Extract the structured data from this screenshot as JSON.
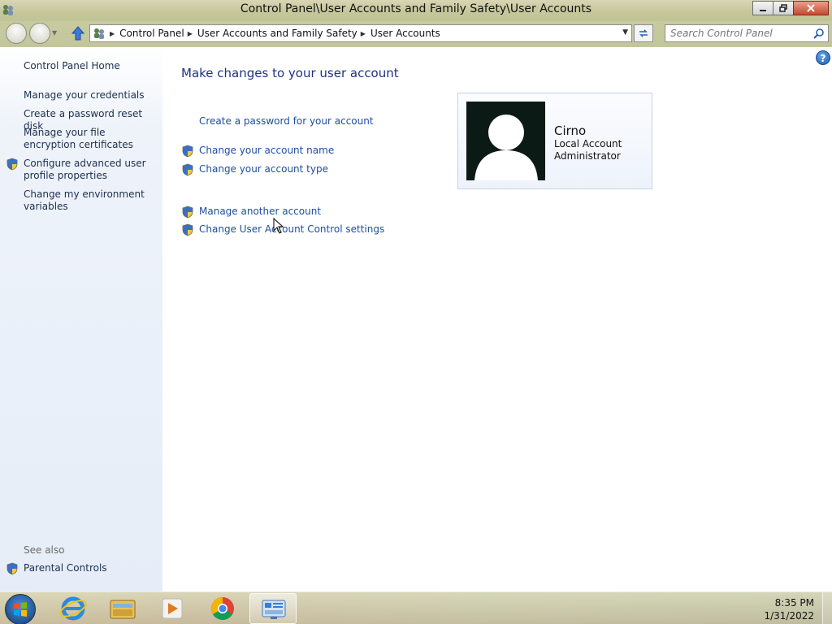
{
  "window": {
    "title": "Control Panel\\User Accounts and Family Safety\\User Accounts"
  },
  "addressbar": {
    "crumbs": [
      "Control Panel",
      "User Accounts and Family Safety",
      "User Accounts"
    ],
    "search_placeholder": "Search Control Panel"
  },
  "sidebar": {
    "home": "Control Panel Home",
    "links": [
      "Manage your credentials",
      "Create a password reset disk",
      "Manage your file encryption certificates",
      "Configure advanced user profile properties",
      "Change my environment variables"
    ],
    "see_also_label": "See also",
    "see_also_links": [
      "Parental Controls"
    ]
  },
  "main": {
    "title": "Make changes to your user account",
    "tasks": [
      "Create a password for your account",
      "Change your account name",
      "Change your account type",
      "Manage another account",
      "Change User Account Control settings"
    ]
  },
  "user": {
    "name": "Cirno",
    "account_kind": "Local Account",
    "role": "Administrator"
  },
  "taskbar": {
    "apps": [
      "internet-explorer-icon",
      "file-explorer-icon",
      "media-player-icon",
      "chrome-icon",
      "control-panel-icon"
    ],
    "time": "8:35 PM",
    "date": "1/31/2022"
  },
  "colors": {
    "link": "#1e4ea0",
    "title": "#1e3287",
    "titlebar": "#c7c89d"
  }
}
